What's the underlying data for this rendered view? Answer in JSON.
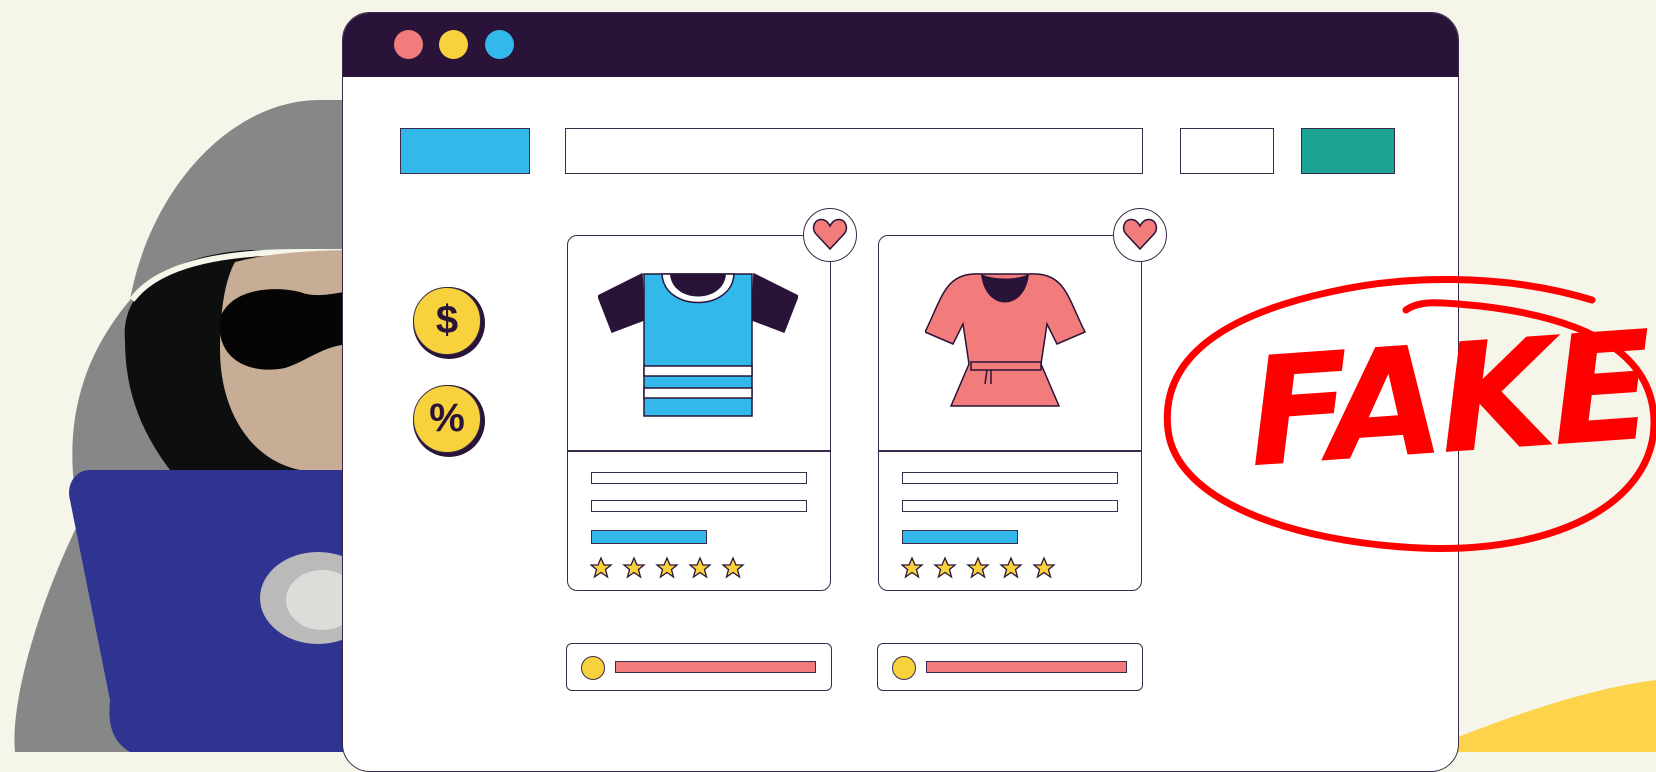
{
  "colors": {
    "background": "#f6f5ea",
    "titlebar": "#2a1338",
    "accent_blue": "#33b8ec",
    "accent_teal": "#1ba393",
    "accent_yellow": "#f7d23c",
    "accent_pink": "#f27b7b",
    "stamp_red": "#ff0000",
    "laptop_blue": "#2e3490"
  },
  "window": {
    "controls": [
      "close",
      "minimize",
      "maximize"
    ]
  },
  "badges": {
    "dollar": "$",
    "percent": "%"
  },
  "products": [
    {
      "icon": "tshirt-icon",
      "rating": 5
    },
    {
      "icon": "dress-icon",
      "rating": 5
    }
  ],
  "stamp": {
    "text": "FAKE!"
  }
}
